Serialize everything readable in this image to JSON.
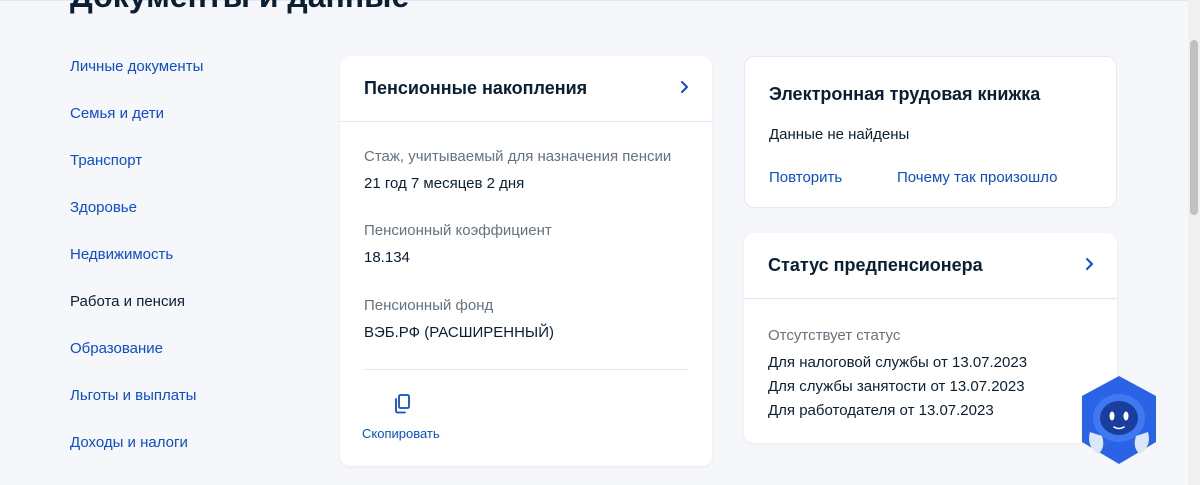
{
  "page": {
    "title": "Документы и данные"
  },
  "sidebar": {
    "items": [
      {
        "label": "Личные документы",
        "active": false
      },
      {
        "label": "Семья и дети",
        "active": false
      },
      {
        "label": "Транспорт",
        "active": false
      },
      {
        "label": "Здоровье",
        "active": false
      },
      {
        "label": "Недвижимость",
        "active": false
      },
      {
        "label": "Работа и пенсия",
        "active": true
      },
      {
        "label": "Образование",
        "active": false
      },
      {
        "label": "Льготы и выплаты",
        "active": false
      },
      {
        "label": "Доходы и налоги",
        "active": false
      }
    ]
  },
  "pension": {
    "title": "Пенсионные накопления",
    "fields": [
      {
        "label": "Стаж, учитываемый для назначения пенсии",
        "value": "21 год 7 месяцев 2 дня"
      },
      {
        "label": "Пенсионный коэффициент",
        "value": "18.134"
      },
      {
        "label": "Пенсионный фонд",
        "value": "ВЭБ.РФ (РАСШИРЕННЫЙ)"
      }
    ],
    "copy_label": "Скопировать"
  },
  "workbook": {
    "title": "Электронная трудовая книжка",
    "status": "Данные не найдены",
    "retry_label": "Повторить",
    "why_label": "Почему так произошло"
  },
  "prepension": {
    "title": "Статус предпенсионера",
    "status_label": "Отсутствует статус",
    "lines": [
      "Для налоговой службы от 13.07.2023",
      "Для службы занятости от 13.07.2023",
      "Для работодателя от 13.07.2023"
    ]
  },
  "colors": {
    "link": "#0d4cd3",
    "text": "#0b1f33",
    "muted": "#66727f",
    "background": "#f5f7fa",
    "assistant": "#2a63e6"
  },
  "icons": {
    "chevron": "chevron-right-icon",
    "copy": "copy-icon",
    "assistant": "robot-assistant-icon"
  }
}
